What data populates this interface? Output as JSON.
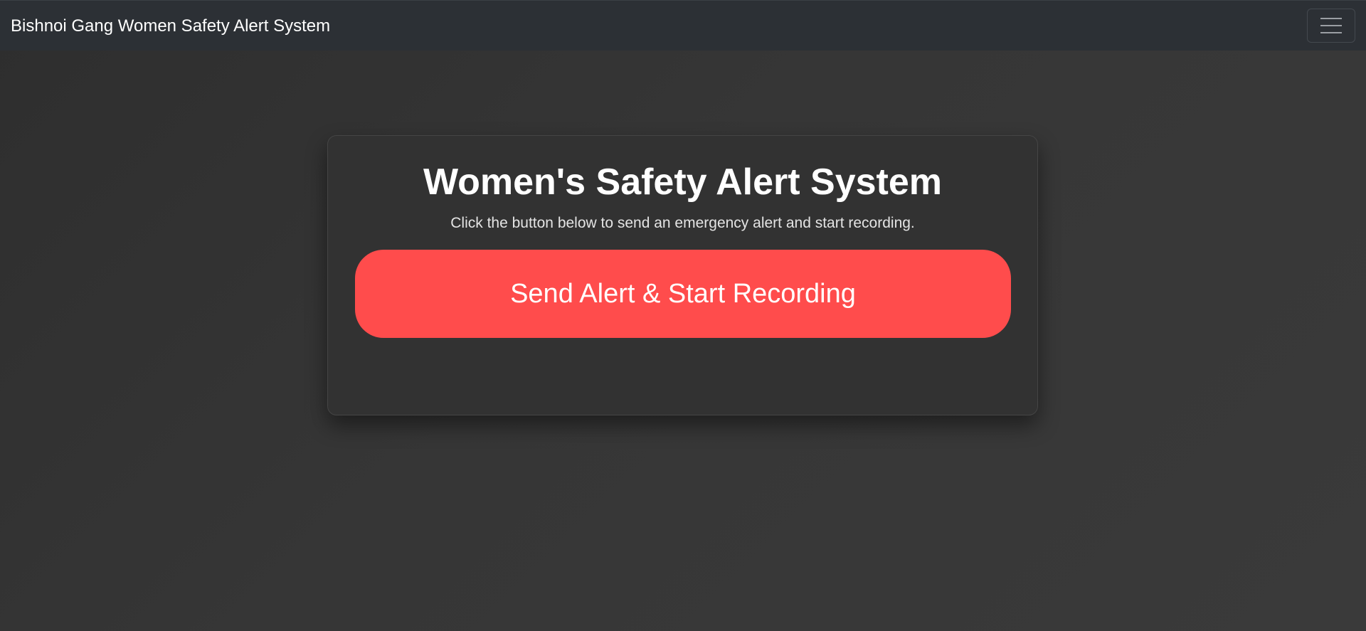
{
  "navbar": {
    "brand": "Bishnoi Gang Women Safety Alert System",
    "toggler_icon": "hamburger-menu-icon"
  },
  "card": {
    "title": "Women's Safety Alert System",
    "description": "Click the button below to send an emergency alert and start recording.",
    "button_label": "Send Alert & Start Recording"
  },
  "colors": {
    "page_background": "#333333",
    "navbar_background": "#2c3035",
    "card_background": "#323232",
    "alert_button": "#ff4c4c",
    "text": "#ffffff"
  }
}
